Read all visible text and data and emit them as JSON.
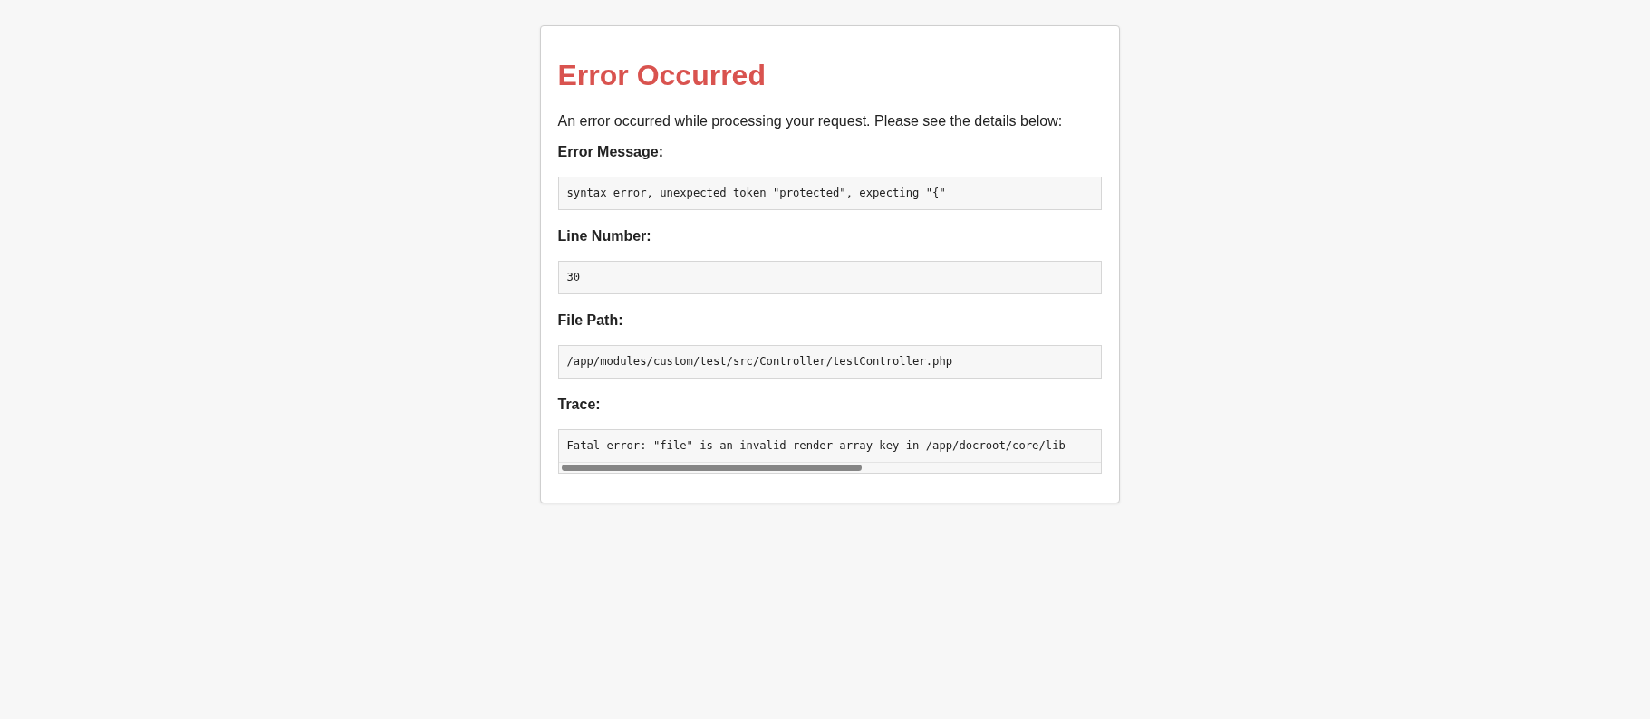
{
  "title": "Error Occurred",
  "intro": "An error occurred while processing your request. Please see the details below:",
  "sections": [
    {
      "label": "Error Message:",
      "value": "syntax error, unexpected token \"protected\", expecting \"{\"",
      "kind": "plain"
    },
    {
      "label": "Line Number:",
      "value": "30",
      "kind": "plain"
    },
    {
      "label": "File Path:",
      "value": "/app/modules/custom/test/src/Controller/testController.php",
      "kind": "plain"
    },
    {
      "label": "Trace:",
      "value": "Fatal error: \"file\" is an invalid render array key in /app/docroot/core/lib",
      "kind": "scroll"
    }
  ]
}
